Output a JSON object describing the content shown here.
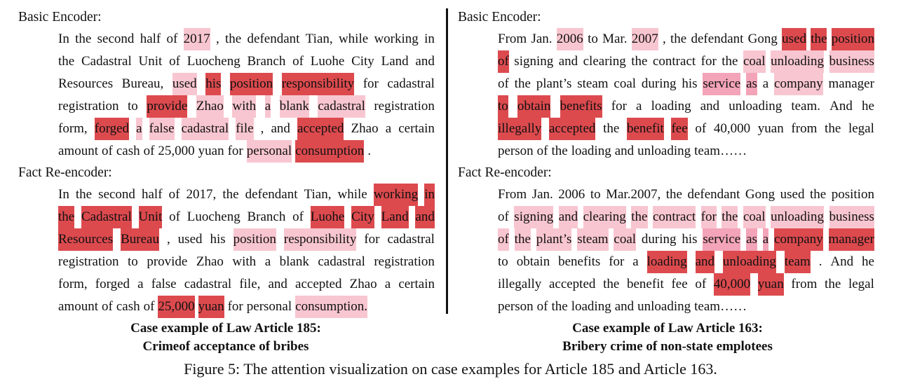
{
  "left": {
    "basic_label": "Basic Encoder:",
    "basic_lines": [
      [
        {
          "t": "In the second half of "
        },
        {
          "t": "2017",
          "h": "light"
        },
        {
          "t": ", the defendant Tian, while working in"
        }
      ],
      [
        {
          "t": "the Cadastral Unit of Luocheng Branch of Luohe City Land and"
        }
      ],
      [
        {
          "t": "Resources Bureau, "
        },
        {
          "t": "used ",
          "h": "light"
        },
        {
          "t": "his position responsibility",
          "h": "strong"
        },
        {
          "t": " for cadastral"
        }
      ],
      [
        {
          "t": "registration to "
        },
        {
          "t": "provide",
          "h": "strong"
        },
        {
          "t": " Zhao with a blank cadastral",
          "h": "light"
        },
        {
          "t": " registration"
        }
      ],
      [
        {
          "t": "form, "
        },
        {
          "t": "forged",
          "h": "strong"
        },
        {
          "t": " a false cadastral file",
          "h": "light"
        },
        {
          "t": ", and "
        },
        {
          "t": "accepted",
          "h": "strong"
        },
        {
          "t": " Zhao a certain"
        }
      ],
      [
        {
          "t": "amount of cash of 25,000 yuan for "
        },
        {
          "t": "personal ",
          "h": "light"
        },
        {
          "t": "consumption",
          "h": "strong"
        },
        {
          "t": "."
        }
      ]
    ],
    "fact_label": "Fact Re-encoder:",
    "fact_lines": [
      [
        {
          "t": "In the second half of 2017, the defendant Tian, while "
        },
        {
          "t": "working in",
          "h": "strong"
        }
      ],
      [
        {
          "t": "the Cadastral Unit",
          "h": "strong"
        },
        {
          "t": " of Luocheng Branch of "
        },
        {
          "t": "Luohe City Land and",
          "h": "strong"
        }
      ],
      [
        {
          "t": "Resources Bureau",
          "h": "strong"
        },
        {
          "t": ", used his "
        },
        {
          "t": "position responsibility",
          "h": "light"
        },
        {
          "t": " for cadastral"
        }
      ],
      [
        {
          "t": "registration to provide Zhao with a blank cadastral registration"
        }
      ],
      [
        {
          "t": "form, forged a false cadastral file, and accepted Zhao a certain"
        }
      ],
      [
        {
          "t": "amount of cash of "
        },
        {
          "t": "25,000 yuan",
          "h": "strong"
        },
        {
          "t": " for personal "
        },
        {
          "t": "consumption.",
          "h": "light"
        }
      ]
    ],
    "caption_line1": "Case example of Law Article 185:",
    "caption_line2": "Crimeof acceptance of bribes"
  },
  "right": {
    "basic_label": "Basic Encoder:",
    "basic_lines": [
      [
        {
          "t": "From Jan. "
        },
        {
          "t": "2006",
          "h": "light"
        },
        {
          "t": " to Mar."
        },
        {
          "t": "2007",
          "h": "light"
        },
        {
          "t": ", the defendant Gong "
        },
        {
          "t": "used the position",
          "h": "strong"
        }
      ],
      [
        {
          "t": "of",
          "h": "strong"
        },
        {
          "t": " signing and clearing the contract for the "
        },
        {
          "t": "coal unloading business",
          "h": "light"
        }
      ],
      [
        {
          "t": "of the plant’s steam coal during his "
        },
        {
          "t": "service as",
          "h": "medium"
        },
        {
          "t": " a "
        },
        {
          "t": "company",
          "h": "light"
        },
        {
          "t": " manager"
        }
      ],
      [
        {
          "t": "to obtain benefits",
          "h": "strong"
        },
        {
          "t": " for a loading and unloading team. And he"
        }
      ],
      [
        {
          "t": "illegally accepted",
          "h": "strong"
        },
        {
          "t": " the "
        },
        {
          "t": "benefit fee",
          "h": "strong"
        },
        {
          "t": " of 40,000 yuan from the legal"
        }
      ],
      [
        {
          "t": "person of the loading and unloading team……"
        }
      ]
    ],
    "fact_label": "Fact Re-encoder:",
    "fact_lines": [
      [
        {
          "t": "From Jan. 2006 to Mar.2007, the defendant Gong used the position"
        }
      ],
      [
        {
          "t": "of "
        },
        {
          "t": "signing and clearing the contract for the coal unloading business",
          "h": "light"
        }
      ],
      [
        {
          "t": "of the plant’s steam coal",
          "h": "light"
        },
        {
          "t": " during his "
        },
        {
          "t": "service as a",
          "h": "medium"
        },
        {
          "t": " "
        },
        {
          "t": "company manager",
          "h": "strong"
        }
      ],
      [
        {
          "t": "to obtain benefits for a "
        },
        {
          "t": "loading and unloading team",
          "h": "strong"
        },
        {
          "t": ". And he"
        }
      ],
      [
        {
          "t": "illegally accepted the benefit fee of "
        },
        {
          "t": "40,000 yuan",
          "h": "strong"
        },
        {
          "t": " from the legal"
        }
      ],
      [
        {
          "t": "person of the loading and unloading team……"
        }
      ]
    ],
    "caption_line1": "Case example of Law Article 163:",
    "caption_line2": "Bribery crime of non-state emplotees"
  },
  "figure_caption": "Figure 5: The attention visualization on case examples for Article 185 and Article 163."
}
